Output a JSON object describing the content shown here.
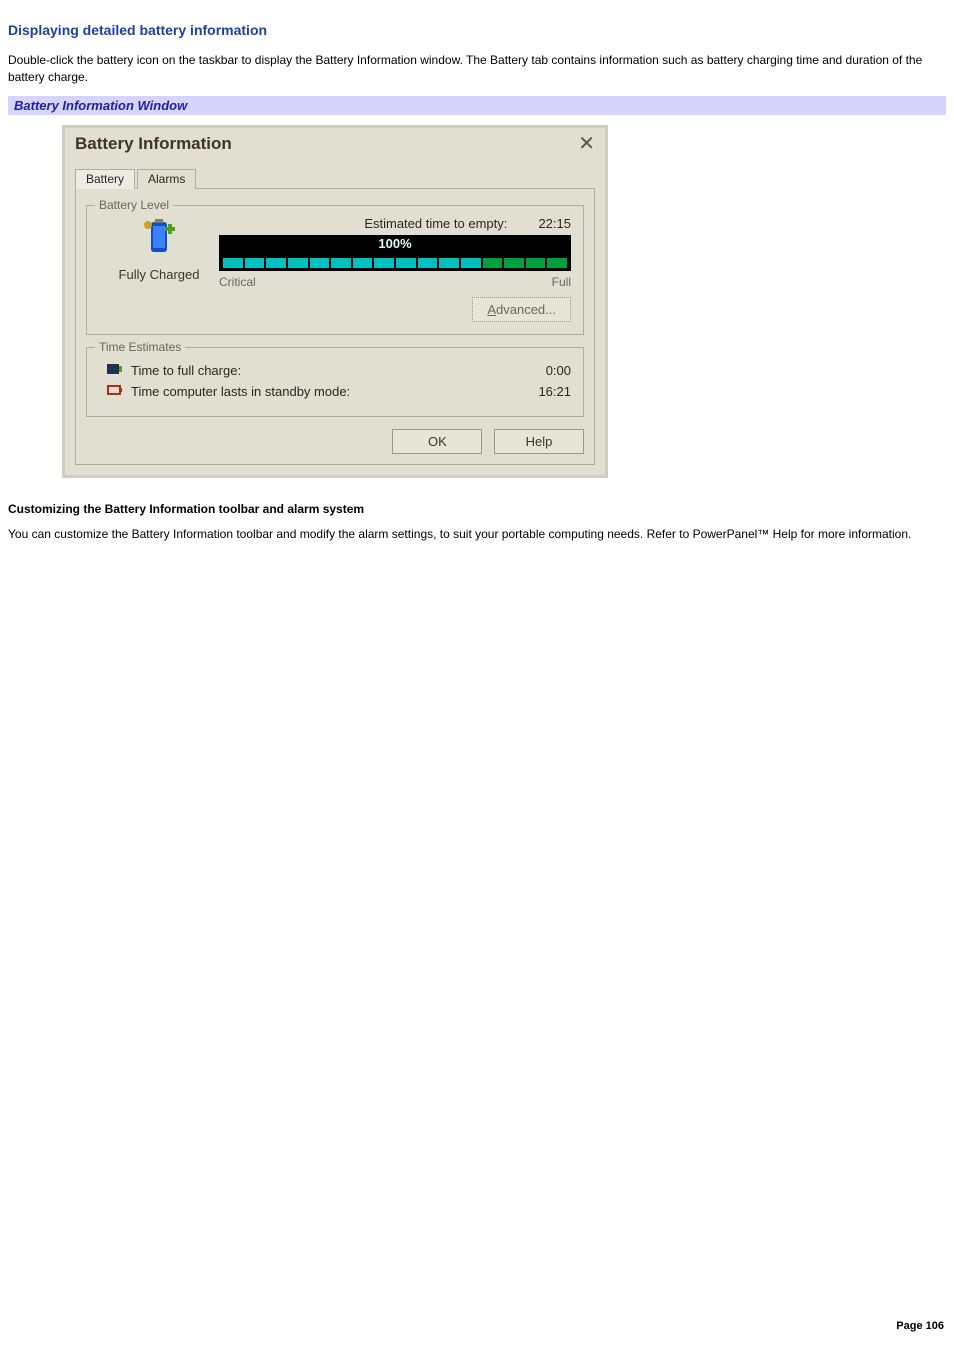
{
  "heading": "Displaying detailed battery information",
  "intro": "Double-click the battery icon on the taskbar to display the Battery Information window. The Battery tab contains information such as battery charging time and duration of the battery charge.",
  "caption": "Battery Information Window",
  "dialog": {
    "title": "Battery Information",
    "tabs": {
      "active": "Battery",
      "inactive": "Alarms"
    },
    "level": {
      "legend": "Battery Level",
      "status": "Fully Charged",
      "est_label": "Estimated time to empty:",
      "est_value": "22:15",
      "percent": "100%",
      "critical": "Critical",
      "full": "Full",
      "advanced": "Advanced..."
    },
    "estimates": {
      "legend": "Time Estimates",
      "row1_label": "Time to full charge:",
      "row1_value": "0:00",
      "row2_label": "Time computer lasts in standby mode:",
      "row2_value": "16:21"
    },
    "ok": "OK",
    "help": "Help"
  },
  "sub_heading": "Customizing the Battery Information toolbar and alarm system",
  "sub_text": "You can customize the Battery Information toolbar and modify the alarm settings, to suit your portable computing needs. Refer to PowerPanel™ Help for more information.",
  "footer": "Page 106"
}
